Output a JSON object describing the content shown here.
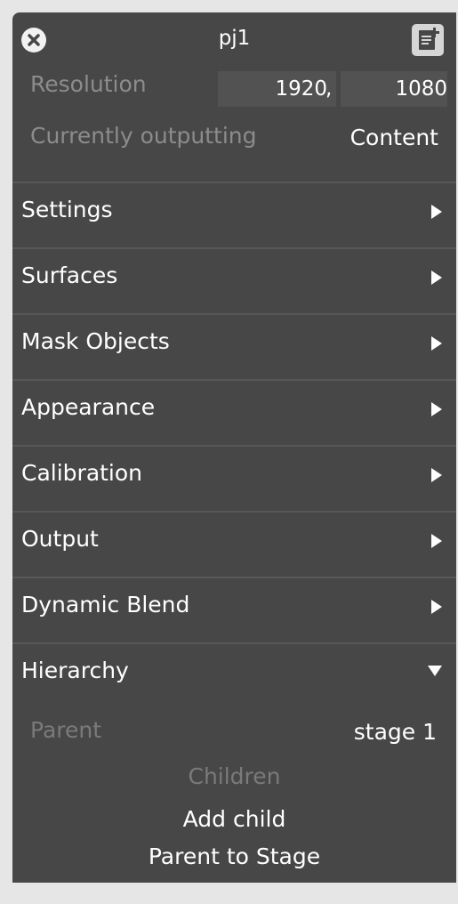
{
  "header": {
    "title": "pj1",
    "close_icon": "close-icon",
    "doc_icon": "add-note-icon"
  },
  "resolution": {
    "label": "Resolution",
    "width": "1920",
    "separator": ",",
    "height": "1080"
  },
  "output_status": {
    "label": "Currently outputting",
    "value": "Content"
  },
  "sections": [
    {
      "label": "Settings",
      "state": "collapsed"
    },
    {
      "label": "Surfaces",
      "state": "collapsed"
    },
    {
      "label": "Mask Objects",
      "state": "collapsed"
    },
    {
      "label": "Appearance",
      "state": "collapsed"
    },
    {
      "label": "Calibration",
      "state": "collapsed"
    },
    {
      "label": "Output",
      "state": "collapsed"
    },
    {
      "label": "Dynamic Blend",
      "state": "collapsed"
    },
    {
      "label": "Hierarchy",
      "state": "expanded"
    }
  ],
  "hierarchy": {
    "parent_label": "Parent",
    "parent_value": "stage 1",
    "children_label": "Children",
    "add_child": "Add child",
    "parent_to_stage": "Parent to Stage"
  },
  "colors": {
    "panel": "#474747",
    "divider": "#575757",
    "dim_text": "#8c8c8c",
    "text": "#ffffff"
  }
}
